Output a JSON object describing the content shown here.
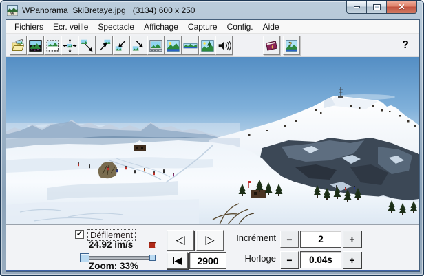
{
  "window": {
    "title": "WPanorama  SkiBretaye.jpg   (3134) 600 x 250"
  },
  "menu": {
    "items": [
      "Fichiers",
      "Ecr. veille",
      "Spectacle",
      "Affichage",
      "Capture",
      "Config.",
      "Aide"
    ]
  },
  "toolbar": {
    "buttons": [
      "open-panorama",
      "display-dark",
      "view-window",
      "pan-free",
      "pan-up-left",
      "pan-up-right",
      "pan-down-left",
      "pan-down-right",
      "screensaver",
      "fullscreen",
      "panorama-strip",
      "slideshow",
      "sound",
      "help-book",
      "about"
    ],
    "help_label": "?"
  },
  "panel": {
    "defilement_label": "Défilement",
    "defilement_checked": true,
    "speed": "24.92 im/s",
    "zoom_label": "Zoom: 33%",
    "position_value": "2900",
    "increment_label": "Incrément",
    "increment_value": "2",
    "clock_label": "Horloge",
    "clock_value": "0.04s"
  },
  "icons": {
    "check": "✓",
    "close": "✕",
    "prev": "◁",
    "next": "▷",
    "first": "◀",
    "minus": "−",
    "plus": "+"
  },
  "colors": {
    "frame": "#9cb2c6",
    "close_button": "#c25340",
    "panel_bg": "#f2f3f6",
    "sky_top": "#5890c4",
    "sky_bottom": "#cfdfee",
    "panel_bottom_line": "#3f63a8"
  }
}
